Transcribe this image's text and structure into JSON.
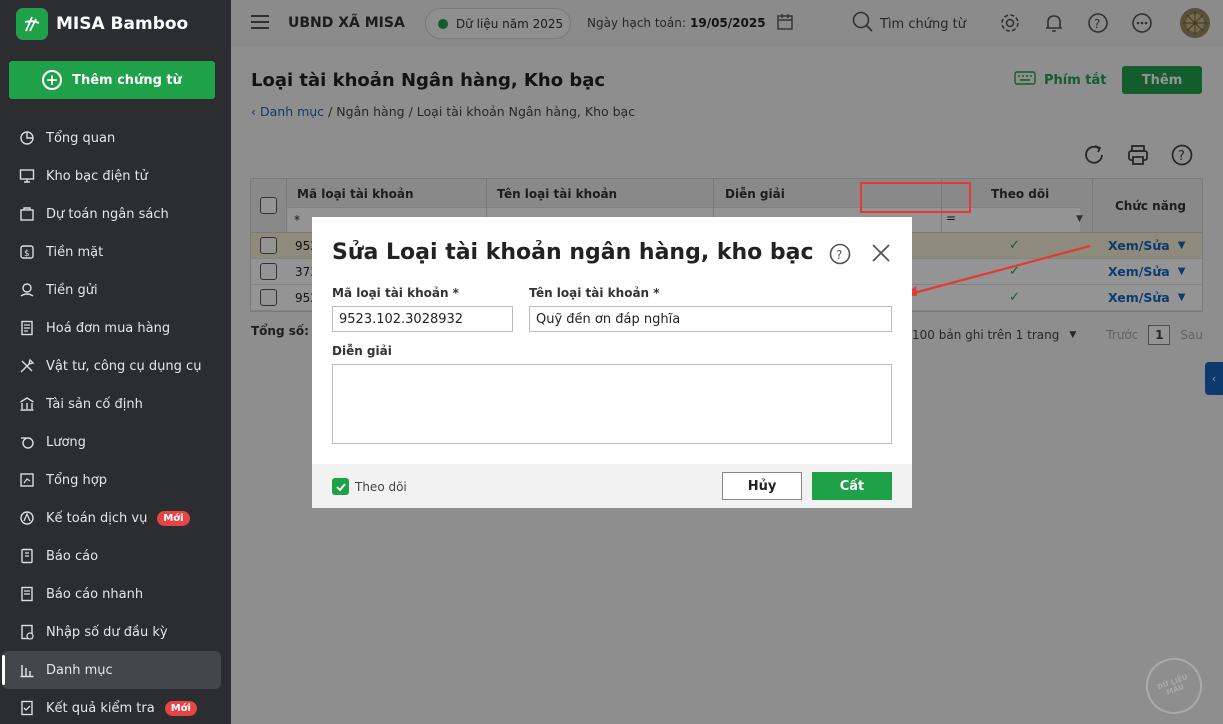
{
  "brand": {
    "name": "MISA Bamboo"
  },
  "sidebar": {
    "add_button": "Thêm chứng từ",
    "items": [
      {
        "label": "Tổng quan",
        "icon": "pie-chart-icon"
      },
      {
        "label": "Kho bạc điện tử",
        "icon": "monitor-icon"
      },
      {
        "label": "Dự toán ngân sách",
        "icon": "budget-icon"
      },
      {
        "label": "Tiền mặt",
        "icon": "cash-icon"
      },
      {
        "label": "Tiền gửi",
        "icon": "deposit-icon"
      },
      {
        "label": "Hoá đơn mua hàng",
        "icon": "invoice-icon"
      },
      {
        "label": "Vật tư, công cụ dụng cụ",
        "icon": "tools-icon"
      },
      {
        "label": "Tài sản cố định",
        "icon": "building-icon"
      },
      {
        "label": "Lương",
        "icon": "salary-icon"
      },
      {
        "label": "Tổng hợp",
        "icon": "summary-icon"
      },
      {
        "label": "Kế toán dịch vụ",
        "icon": "service-icon",
        "badge": "Mới"
      },
      {
        "label": "Báo cáo",
        "icon": "report-icon"
      },
      {
        "label": "Báo cáo nhanh",
        "icon": "quick-report-icon"
      },
      {
        "label": "Nhập số dư đầu kỳ",
        "icon": "opening-balance-icon"
      },
      {
        "label": "Danh mục",
        "icon": "catalog-icon",
        "active": true
      },
      {
        "label": "Kết quả kiểm tra",
        "icon": "check-result-icon",
        "badge": "Mới"
      }
    ]
  },
  "topbar": {
    "org": "UBND XÃ MISA",
    "year": "Dữ liệu năm 2025",
    "posting_label": "Ngày hạch toán:",
    "posting_date": "19/05/2025",
    "search_placeholder": "Tìm chứng từ"
  },
  "main": {
    "title": "Loại tài khoản Ngân hàng, Kho bạc",
    "hotkeys": "Phím tắt",
    "add": "Thêm",
    "breadcrumb": [
      "Danh mục",
      "/",
      "Ngân hàng",
      "/",
      "Loại tài khoản Ngân hàng, Kho bạc"
    ],
    "columns": [
      "Mã loại tài khoản",
      "Tên loại tài khoản",
      "Diễn giải",
      "Theo dõi",
      "Chức năng"
    ],
    "filter_star": "*",
    "filter_eq": "=",
    "rows": [
      {
        "code": "952",
        "action": "Xem/Sửa"
      },
      {
        "code": "373",
        "action": "Xem/Sửa"
      },
      {
        "code": "952",
        "action": "Xem/Sửa"
      }
    ],
    "total": "Tổng số: 3",
    "pager_text": "100 bản ghi trên 1 trang",
    "prev": "Trước",
    "page": "1",
    "next": "Sau"
  },
  "dialog": {
    "title": "Sửa Loại tài khoản ngân hàng, kho bạc",
    "code_label": "Mã loại tài khoản *",
    "code_value": "9523.102.3028932",
    "name_label": "Tên loại tài khoản *",
    "name_value": "Quỹ đền ơn đáp nghĩa",
    "desc_label": "Diễn giải",
    "follow_label": "Theo dõi",
    "cancel": "Hủy",
    "save": "Cất"
  },
  "stamp_text": "DỮ LIỆU MẪU",
  "colors": {
    "green": "#1fa14a",
    "blue": "#1565c0",
    "red": "#e53935",
    "sidebar": "#2b2d31"
  }
}
